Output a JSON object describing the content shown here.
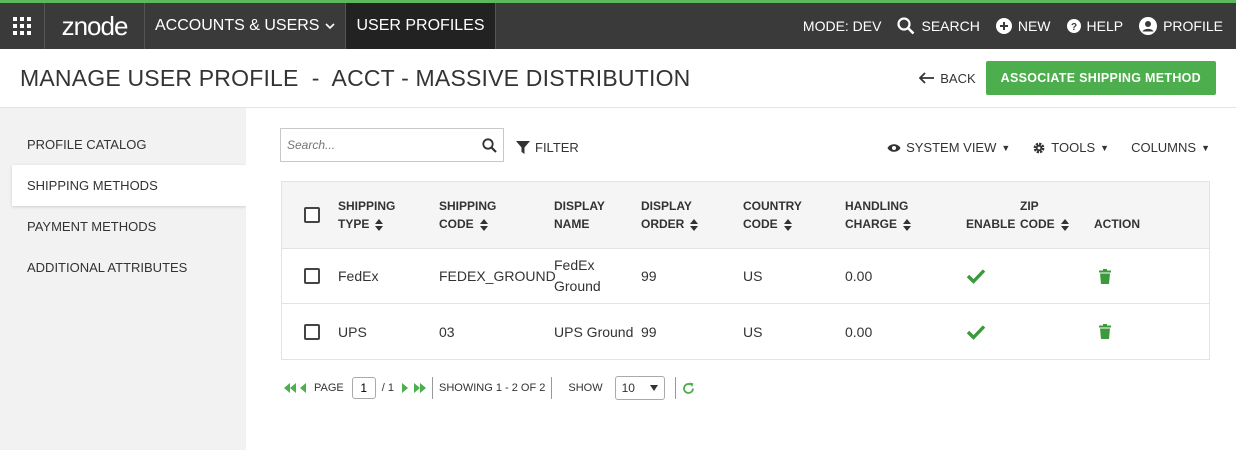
{
  "topbar": {
    "logo": "znode",
    "nav": [
      {
        "label": "ACCOUNTS & USERS"
      },
      {
        "label": "USER PROFILES"
      }
    ],
    "mode": "MODE: DEV",
    "search": "SEARCH",
    "new": "NEW",
    "help": "HELP",
    "profile": "PROFILE",
    "accent": "#5cb85c"
  },
  "header": {
    "title": "MANAGE USER PROFILE  -  ACCT - MASSIVE DISTRIBUTION",
    "back": "BACK",
    "primary": "ASSOCIATE SHIPPING METHOD"
  },
  "sidebar": {
    "items": [
      {
        "label": "PROFILE CATALOG"
      },
      {
        "label": "SHIPPING METHODS"
      },
      {
        "label": "PAYMENT METHODS"
      },
      {
        "label": "ADDITIONAL ATTRIBUTES"
      }
    ],
    "active_index": 1
  },
  "toolbar": {
    "search_placeholder": "Search...",
    "filter": "FILTER",
    "system_view": "SYSTEM VIEW",
    "tools": "TOOLS",
    "columns": "COLUMNS"
  },
  "grid": {
    "headers": {
      "shipping_type_1": "SHIPPING",
      "shipping_type_2": "TYPE",
      "shipping_code_1": "SHIPPING",
      "shipping_code_2": "CODE",
      "display_name_1": "DISPLAY",
      "display_name_2": "NAME",
      "display_order_1": "DISPLAY",
      "display_order_2": "ORDER",
      "country_code_1": "COUNTRY",
      "country_code_2": "CODE",
      "handling_1": "HANDLING",
      "handling_2": "CHARGE",
      "enable": "ENABLE",
      "zip_1": "ZIP",
      "zip_2": "CODE",
      "action": "ACTION"
    },
    "rows": [
      {
        "type": "FedEx",
        "code": "FEDEX_GROUND",
        "name_1": "FedEx",
        "name_2": "Ground",
        "order": "99",
        "country": "US",
        "handling": "0.00",
        "enabled": true
      },
      {
        "type": "UPS",
        "code": "03",
        "name_1": "UPS Ground",
        "name_2": "",
        "order": "99",
        "country": "US",
        "handling": "0.00",
        "enabled": true
      }
    ]
  },
  "pager": {
    "page_label": "PAGE",
    "page": "1",
    "of": "/ 1",
    "showing": "SHOWING 1 - 2 OF 2",
    "show_label": "SHOW",
    "page_size": "10"
  }
}
